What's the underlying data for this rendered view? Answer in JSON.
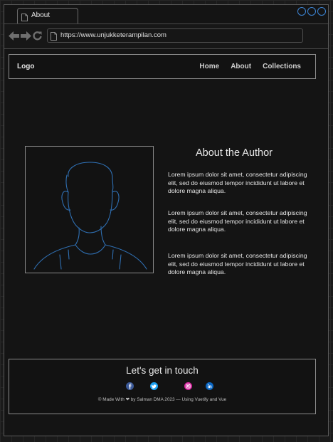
{
  "browser": {
    "tab_title": "About",
    "url": "https://www.unjukketerampilan.com"
  },
  "header": {
    "logo": "Logo",
    "nav": [
      "Home",
      "About",
      "Collections"
    ]
  },
  "about": {
    "title": "About the Author",
    "paragraphs": [
      "Lorem ipsum dolor sit amet, consectetur adipiscing elit, sed do eiusmod tempor incididunt ut labore et dolore magna aliqua.",
      "Lorem ipsum dolor sit amet, consectetur adipiscing elit, sed do eiusmod tempor incididunt ut labore et dolore magna aliqua.",
      "Lorem ipsum dolor sit amet, consectetur adipiscing elit, sed do eiusmod tempor incididunt ut labore et dolore magna aliqua."
    ]
  },
  "footer": {
    "title": "Let's get in touch",
    "credits": "© Made With ❤ by Salman DMA 2023 — Using Vuetify and Vue",
    "social": [
      {
        "icon": "facebook-icon",
        "color": "#3b5998"
      },
      {
        "icon": "twitter-icon",
        "color": "#1da1f2"
      },
      {
        "icon": "instagram-icon",
        "color": "#d6249f"
      },
      {
        "icon": "linkedin-icon",
        "color": "#0a66c2"
      }
    ]
  },
  "colors": {
    "accent": "#3d86d6",
    "background": "#141414"
  }
}
